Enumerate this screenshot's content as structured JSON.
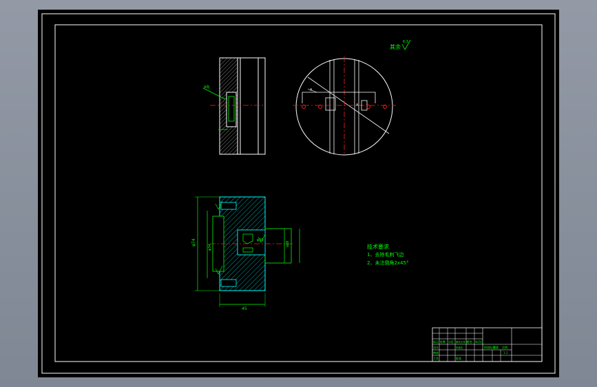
{
  "drawing": {
    "roughness_note": "其余",
    "roughness_value": "6.3",
    "tech_title": "技术要求",
    "tech_items": [
      "1、去除毛刺飞边",
      "2、未注倒角2x45°"
    ],
    "dims": {
      "width_bottom": "45",
      "height_left": "φ74",
      "inner_dia": "φ34",
      "bore": "φ30",
      "right_height": "38",
      "small": "8"
    }
  },
  "title_block": {
    "cells": [
      "标记",
      "处数",
      "分区",
      "更改文件号",
      "签名",
      "年月日",
      "设计",
      "标准化",
      "审核",
      "工艺",
      "批准",
      "阶段标记",
      "重量",
      "比例",
      "1:1"
    ]
  },
  "colors": {
    "line": "#ffffff",
    "dim": "#00ff00",
    "center": "#ff2020",
    "hatch": "#00ffff",
    "text": "#00ff00"
  }
}
